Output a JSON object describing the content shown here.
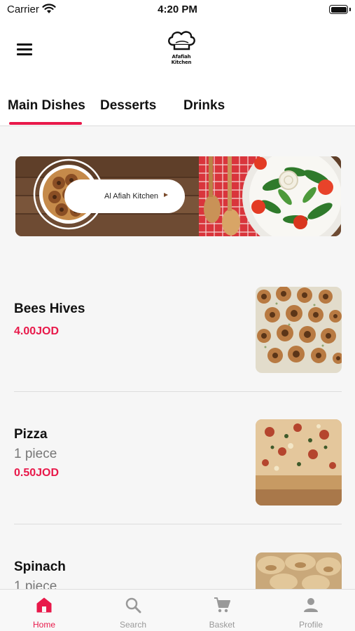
{
  "status_bar": {
    "carrier": "Carrier",
    "time": "4:20 PM"
  },
  "header": {
    "logo_text": "Afafiah Kitchen"
  },
  "tabs": [
    {
      "label": "Main Dishes",
      "active": true
    },
    {
      "label": "Desserts",
      "active": false
    },
    {
      "label": "Drinks",
      "active": false
    }
  ],
  "banner": {
    "text": "Al Afiah Kitchen"
  },
  "items": [
    {
      "name": "Bees Hives",
      "subtitle": "",
      "price": "4.00JOD"
    },
    {
      "name": "Pizza",
      "subtitle": "1 piece",
      "price": "0.50JOD"
    },
    {
      "name": "Spinach",
      "subtitle": "1 piece",
      "price": ""
    }
  ],
  "bottom_nav": [
    {
      "label": "Home",
      "icon": "home-icon",
      "active": true
    },
    {
      "label": "Search",
      "icon": "search-icon",
      "active": false
    },
    {
      "label": "Basket",
      "icon": "cart-icon",
      "active": false
    },
    {
      "label": "Profile",
      "icon": "profile-icon",
      "active": false
    }
  ],
  "colors": {
    "accent": "#e8194a",
    "background": "#f6f6f6",
    "inactive": "#999999"
  }
}
